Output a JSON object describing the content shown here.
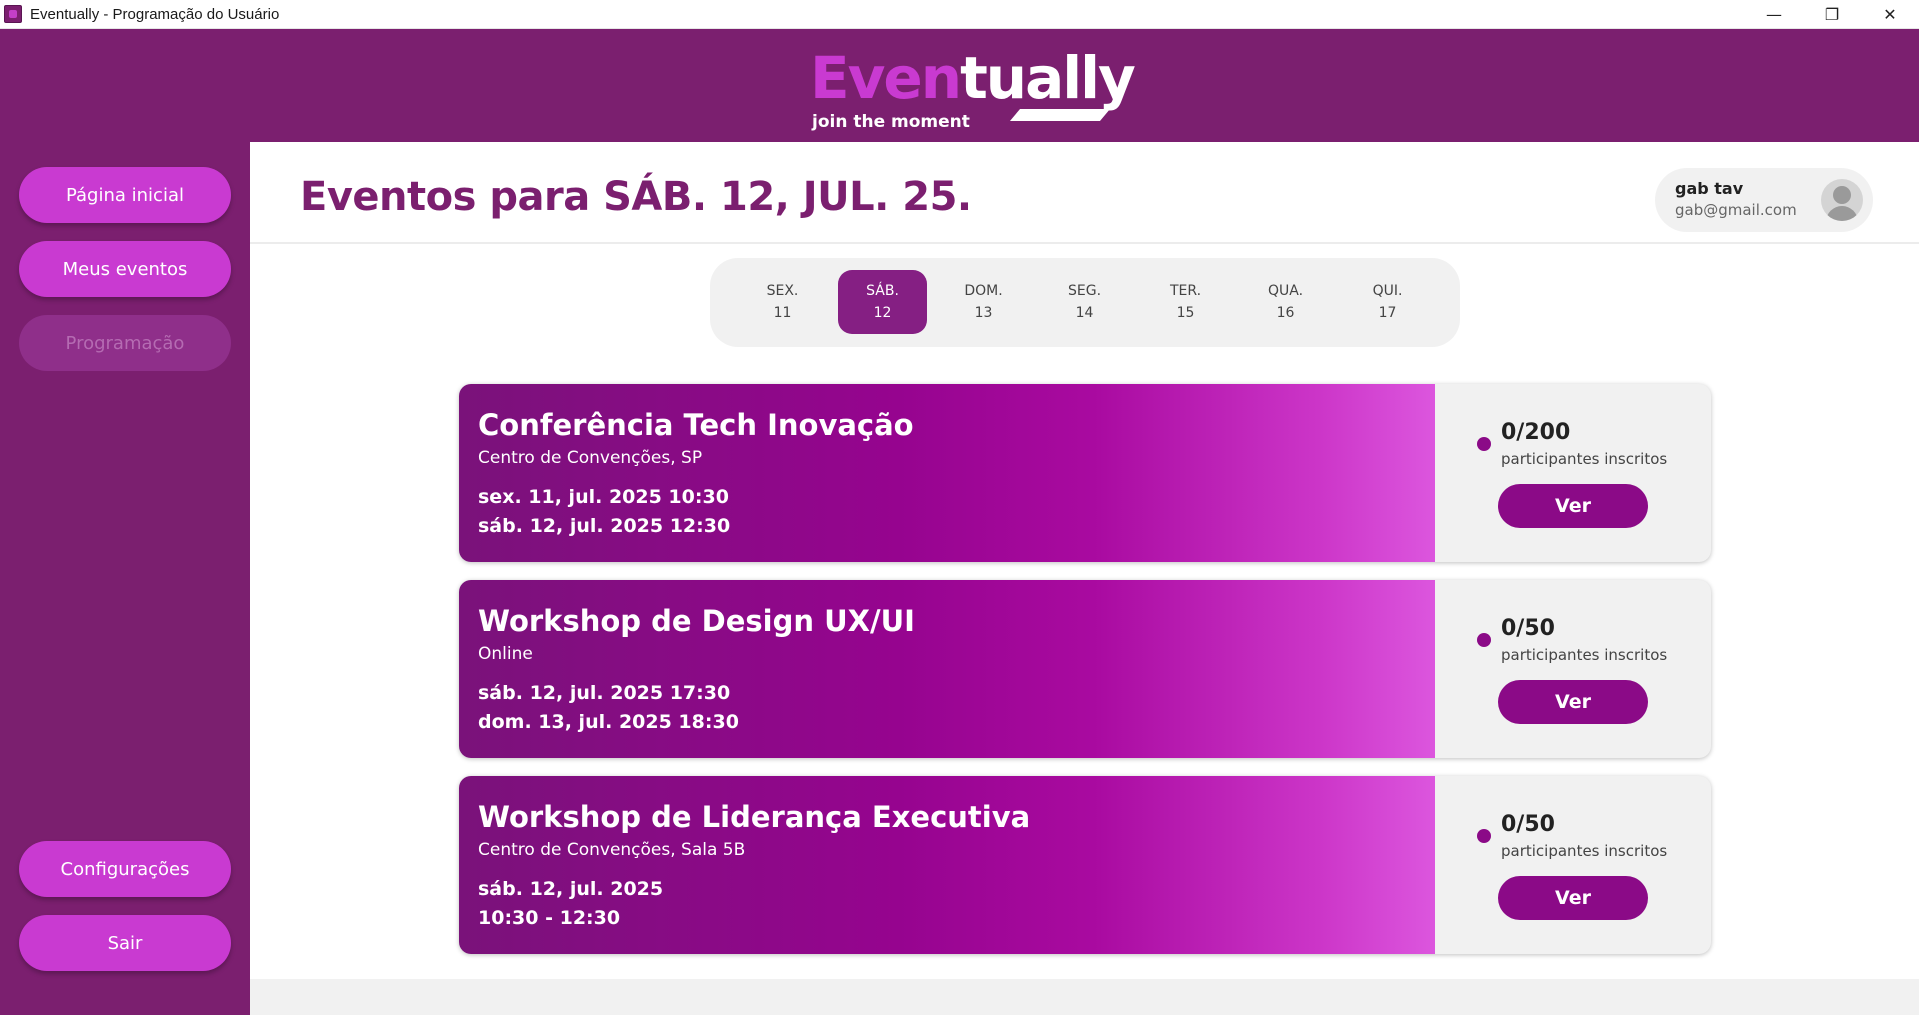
{
  "window": {
    "title": "Eventually - Programação do Usuário",
    "minimize_glyph": "—",
    "restore_glyph": "❐",
    "close_glyph": "✕"
  },
  "logo": {
    "word_part1": "Even",
    "word_part2": "tually",
    "tagline": "join the moment"
  },
  "sidebar": {
    "items": [
      {
        "label": "Página inicial",
        "state": "normal"
      },
      {
        "label": "Meus eventos",
        "state": "normal"
      },
      {
        "label": "Programação",
        "state": "disabled"
      }
    ],
    "bottom_items": [
      {
        "label": "Configurações"
      },
      {
        "label": "Sair"
      }
    ]
  },
  "main": {
    "title": "Eventos para SÁB. 12, JUL. 25."
  },
  "user": {
    "name": "gab tav",
    "email": "gab@gmail.com"
  },
  "days": [
    {
      "dow": "SEX.",
      "num": "11",
      "active": false
    },
    {
      "dow": "SÁB.",
      "num": "12",
      "active": true
    },
    {
      "dow": "DOM.",
      "num": "13",
      "active": false
    },
    {
      "dow": "SEG.",
      "num": "14",
      "active": false
    },
    {
      "dow": "TER.",
      "num": "15",
      "active": false
    },
    {
      "dow": "QUA.",
      "num": "16",
      "active": false
    },
    {
      "dow": "QUI.",
      "num": "17",
      "active": false
    }
  ],
  "events": [
    {
      "title": "Conferência Tech Inovação",
      "location": "Centro de Convenções, SP",
      "line1": "sex. 11, jul. 2025 10:30",
      "line2": "sáb. 12, jul. 2025 12:30",
      "count": "0/200",
      "count_label": "participantes inscritos",
      "button": "Ver"
    },
    {
      "title": "Workshop de Design UX/UI",
      "location": "Online",
      "line1": "sáb. 12, jul. 2025 17:30",
      "line2": "dom. 13, jul. 2025 18:30",
      "count": "0/50",
      "count_label": "participantes inscritos",
      "button": "Ver"
    },
    {
      "title": "Workshop de Liderança Executiva",
      "location": "Centro de Convenções, Sala 5B",
      "line1": "sáb. 12, jul. 2025",
      "line2": "10:30 - 12:30",
      "count": "0/50",
      "count_label": "participantes inscritos",
      "button": "Ver"
    }
  ],
  "colors": {
    "brand_purple": "#7b1f6f",
    "accent_magenta": "#c93ad1",
    "active_day": "#851f83",
    "button_purple": "#8b0a87"
  },
  "icons": [
    "app-icon",
    "minimize-icon",
    "restore-icon",
    "close-icon",
    "avatar-icon",
    "status-dot-icon"
  ]
}
